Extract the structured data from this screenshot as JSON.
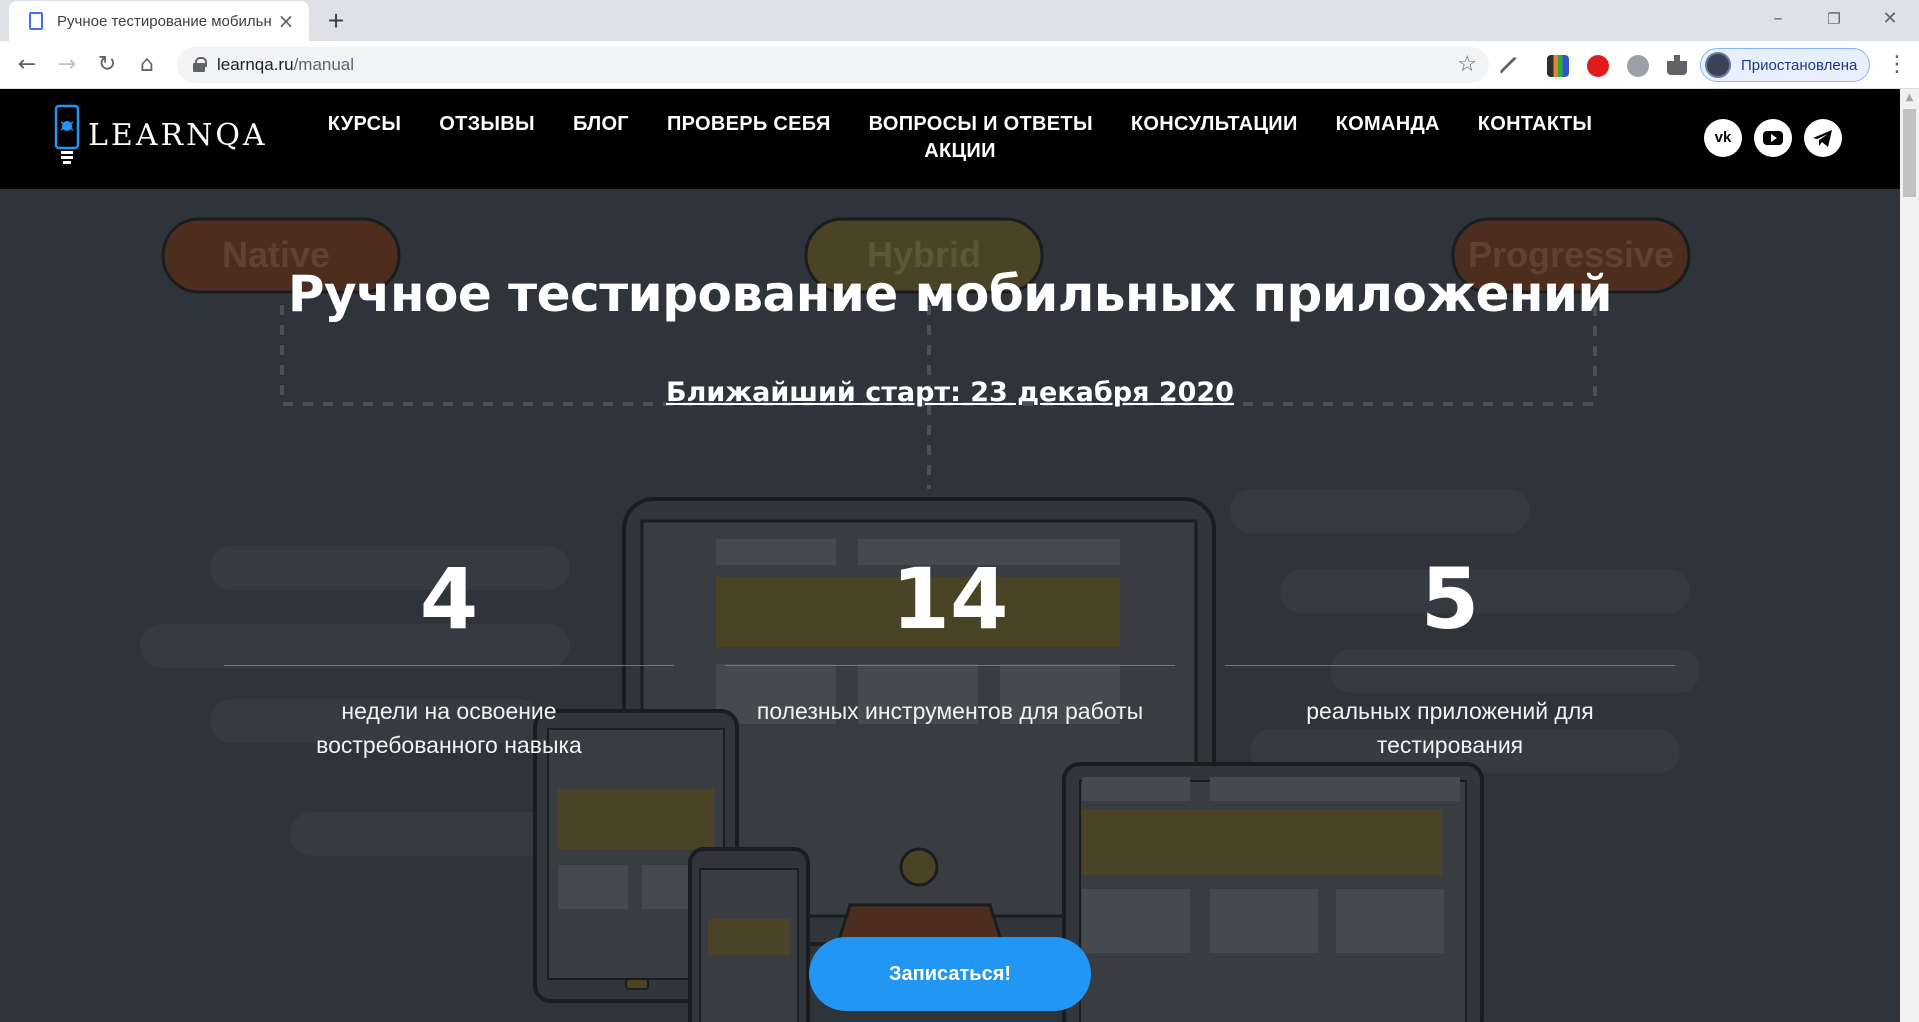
{
  "browser": {
    "tab_title": "Ручное тестирование мобильн",
    "new_tab": "+",
    "url_host": "learnqa.ru",
    "url_path": "/manual",
    "profile_label": "Приостановлена"
  },
  "site": {
    "logo_text": "LEARNQA",
    "nav": [
      "КУРСЫ",
      "ОТЗЫВЫ",
      "БЛОГ",
      "ПРОВЕРЬ СЕБЯ",
      "ВОПРОСЫ И ОТВЕТЫ",
      "КОНСУЛЬТАЦИИ",
      "КОМАНДА",
      "КОНТАКТЫ",
      "АКЦИИ"
    ],
    "social": [
      "vk-icon",
      "youtube-icon",
      "telegram-icon"
    ]
  },
  "background": {
    "pills": [
      "Native",
      "Hybrid",
      "Progressive"
    ]
  },
  "hero": {
    "title": "Ручное тестирование мобильных приложений",
    "next_start": "Ближайший старт: 23 декабря 2020",
    "stats": [
      {
        "number": "4",
        "text_lines": [
          "недели на освоение",
          "востребованного навыка"
        ]
      },
      {
        "number": "14",
        "text_lines": [
          "полезных инструментов для работы"
        ]
      },
      {
        "number": "5",
        "text_lines": [
          "реальных приложений для",
          "тестирования"
        ]
      }
    ],
    "cta_label": "Записаться!"
  },
  "colors": {
    "header_bg": "#000000",
    "hero_bg": "#2e3439",
    "cta": "#2196f3",
    "accent_yellow": "#4a4325"
  }
}
